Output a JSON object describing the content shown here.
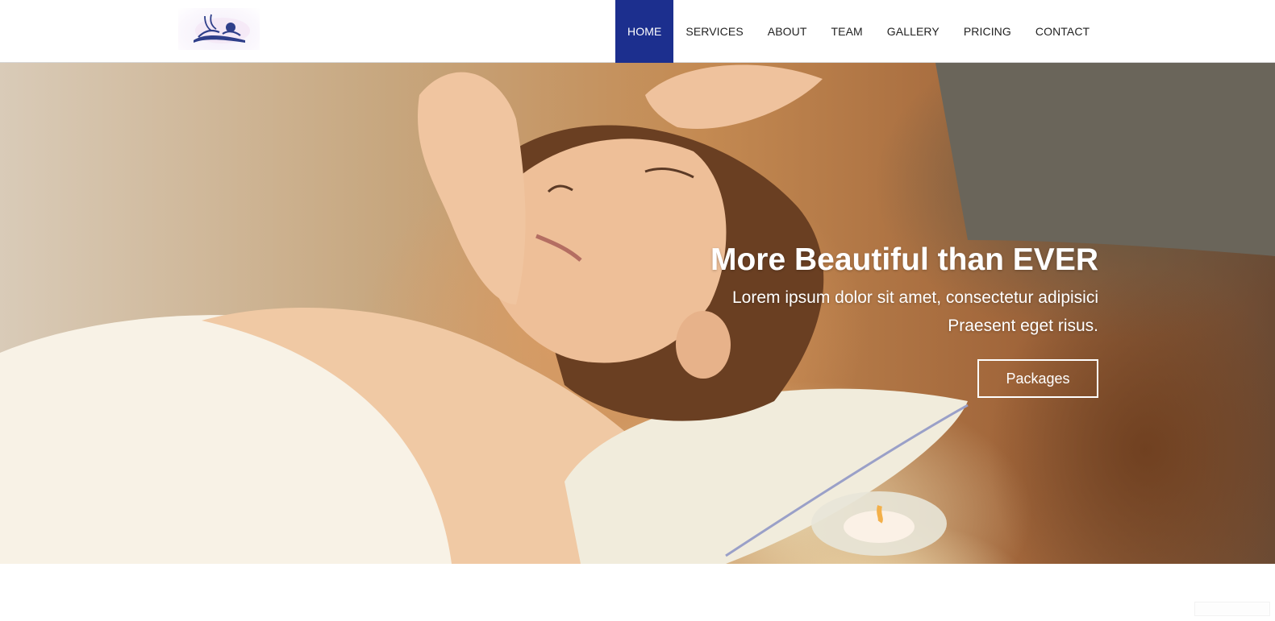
{
  "brand": {
    "logo_icon": "spa-massage-logo-icon"
  },
  "nav": {
    "items": [
      {
        "label": "HOME",
        "active": true
      },
      {
        "label": "SERVICES",
        "active": false
      },
      {
        "label": "ABOUT",
        "active": false
      },
      {
        "label": "TEAM",
        "active": false
      },
      {
        "label": "GALLERY",
        "active": false
      },
      {
        "label": "PRICING",
        "active": false
      },
      {
        "label": "CONTACT",
        "active": false
      }
    ]
  },
  "hero": {
    "title": "More Beautiful than EVER",
    "subtitle_line1": "Lorem ipsum dolor sit amet, consectetur adipisici",
    "subtitle_line2": "Praesent eget risus.",
    "button_label": "Packages"
  },
  "colors": {
    "accent": "#1c2f8e",
    "nav_text": "#222222",
    "hero_text": "#ffffff"
  }
}
